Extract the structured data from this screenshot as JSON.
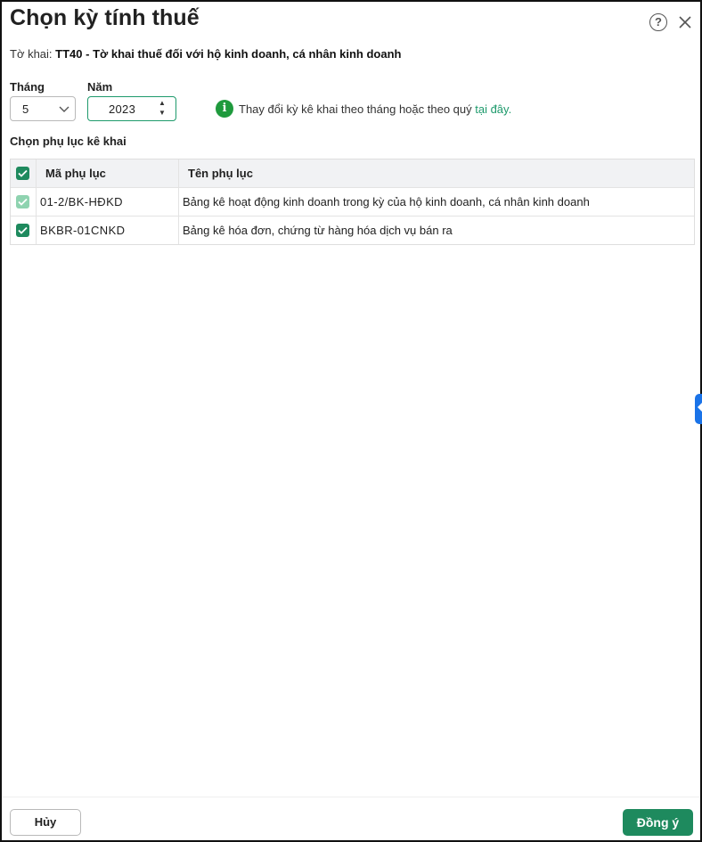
{
  "dialog": {
    "title": "Chọn kỳ tính thuế",
    "help_icon": "question-circle-icon",
    "close_icon": "close-icon"
  },
  "form": {
    "label": "Tờ khai:",
    "value": "TT40 - Tờ khai thuế đối với hộ kinh doanh, cá nhân kinh doanh"
  },
  "period": {
    "month_label": "Tháng",
    "month_value": "5",
    "year_label": "Năm",
    "year_value": "2023"
  },
  "info": {
    "icon": "info-circle-icon",
    "text": "Thay đổi kỳ kê khai theo tháng hoặc theo quý ",
    "link": "tại đây."
  },
  "appendix": {
    "section_title": "Chọn phụ lục kê khai",
    "columns": [
      "Mã phụ lục",
      "Tên phụ lục"
    ],
    "rows": [
      {
        "code": "01-2/BK-HĐKD",
        "name": "Bảng kê hoạt động kinh doanh trong kỳ của hộ kinh doanh, cá nhân kinh doanh",
        "checked": true,
        "disabled": true
      },
      {
        "code": "BKBR-01CNKD",
        "name": "Bảng kê hóa đơn, chứng từ hàng hóa dịch vụ bán ra",
        "checked": true,
        "disabled": false
      }
    ]
  },
  "footer": {
    "cancel_label": "Hủy",
    "ok_label": "Đồng ý"
  },
  "colors": {
    "accent": "#1e8a5e",
    "link": "#1e9a6c",
    "info": "#1f9a3d",
    "side_tab": "#1a73e8"
  }
}
